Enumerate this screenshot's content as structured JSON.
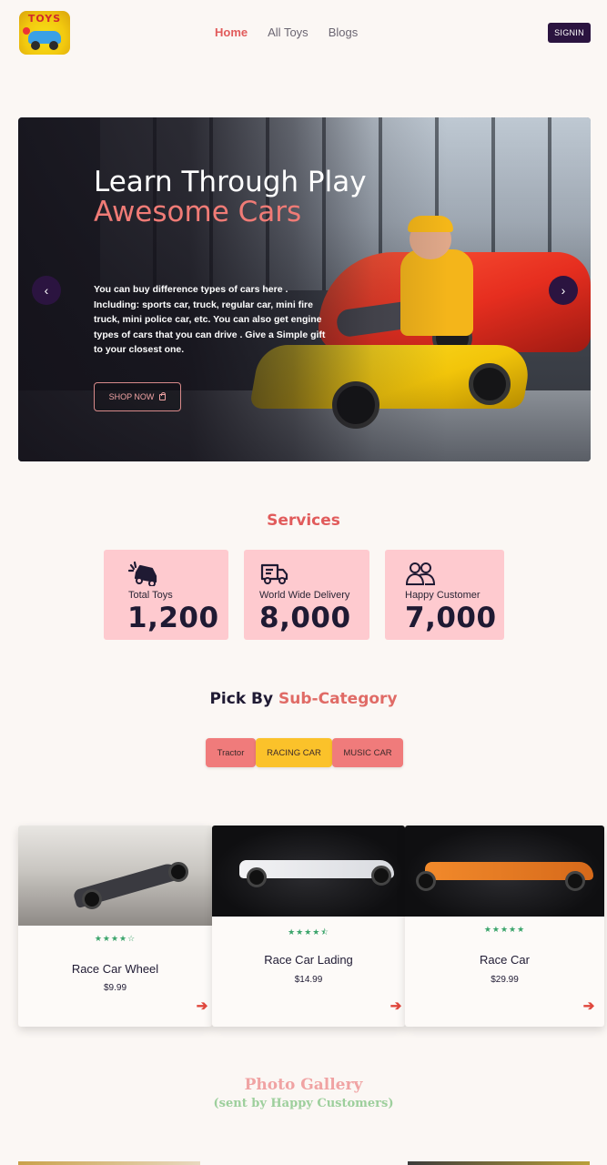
{
  "nav": {
    "logo_text": "TOYS",
    "links": [
      "Home",
      "All Toys",
      "Blogs"
    ],
    "signin": "SIGNIN"
  },
  "hero": {
    "title_plain": "Learn Through Play",
    "title_accent": "Awesome Cars",
    "description": "You can buy difference types of cars here . Including: sports car, truck, regular car, mini fire truck, mini police car, etc. You can also get engine types of cars that you can drive . Give a Simple gift to your closest one.",
    "button": "SHOP NOW",
    "prev_arrow": "‹",
    "next_arrow": "›"
  },
  "services": {
    "title": "Services",
    "items": [
      {
        "label": "Total Toys",
        "value": "1,200",
        "icon": "car-crash-icon"
      },
      {
        "label": "World Wide Delivery",
        "value": "8,000",
        "icon": "truck-icon"
      },
      {
        "label": "Happy Customer",
        "value": "7,000",
        "icon": "users-icon"
      }
    ]
  },
  "subcategory": {
    "title_plain": "Pick By",
    "title_accent": "Sub-Category",
    "tabs": [
      "Tractor",
      "RACING CAR",
      "MUSIC CAR"
    ]
  },
  "products": [
    {
      "name": "Race Car Wheel",
      "price": "$9.99",
      "stars": "★★★★☆"
    },
    {
      "name": "Race Car Lading",
      "price": "$14.99",
      "stars": "★★★★⯪"
    },
    {
      "name": "Race Car",
      "price": "$29.99",
      "stars": "★★★★★"
    }
  ],
  "gallery": {
    "title": "Photo Gallery",
    "subtitle": "(sent by Happy Customers)"
  },
  "colors": {
    "accent": "#e15b5b",
    "dark": "#2b1440",
    "card_pink": "#fecacf",
    "tab_yellow": "#fbc22a",
    "star_green": "#3ba46b"
  }
}
